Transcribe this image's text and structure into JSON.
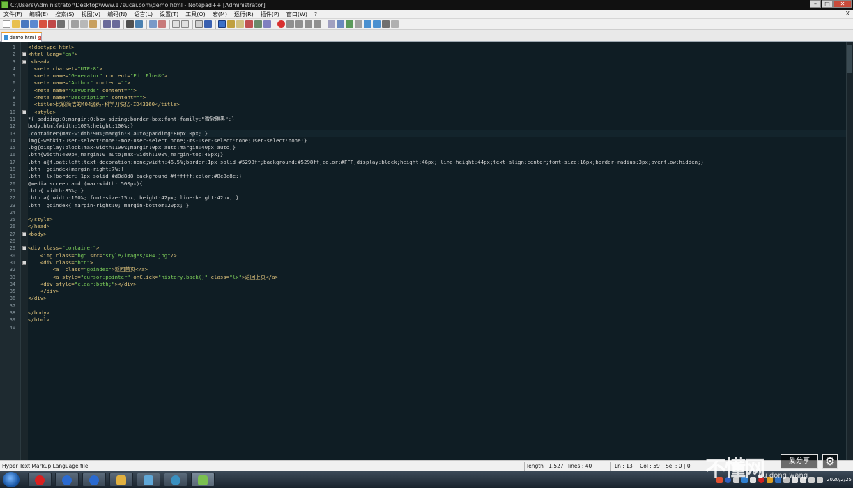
{
  "window": {
    "title": "C:\\Users\\Administrator\\Desktop\\www.17sucai.com\\demo.html - Notepad++ [Administrator]",
    "min": "–",
    "max": "□",
    "close": "✕"
  },
  "menu": [
    "文件(F)",
    "编辑(E)",
    "搜索(S)",
    "视图(V)",
    "编码(N)",
    "语言(L)",
    "设置(T)",
    "工具(O)",
    "宏(M)",
    "运行(R)",
    "插件(P)",
    "窗口(W)",
    "?"
  ],
  "menu_close": "X",
  "tab": {
    "label": "demo.html",
    "close": "x"
  },
  "code_lines": [
    {
      "n": "1",
      "text": "<!doctype html>",
      "fold": false
    },
    {
      "n": "2",
      "text": "<html lang=\"en\">",
      "fold": true
    },
    {
      "n": "3",
      "text": " <head>",
      "fold": true
    },
    {
      "n": "4",
      "text": "  <meta charset=\"UTF-8\">",
      "fold": false
    },
    {
      "n": "5",
      "text": "  <meta name=\"Generator\" content=\"EditPlus®\">",
      "fold": false
    },
    {
      "n": "6",
      "text": "  <meta name=\"Author\" content=\"\">",
      "fold": false
    },
    {
      "n": "7",
      "text": "  <meta name=\"Keywords\" content=\"\">",
      "fold": false
    },
    {
      "n": "8",
      "text": "  <meta name=\"Description\" content=\"\">",
      "fold": false
    },
    {
      "n": "9",
      "text": "  <title>比较简洁的404源码-科学刀佚亿-ID43160</title>",
      "fold": false
    },
    {
      "n": "10",
      "text": "  <style>",
      "fold": true
    },
    {
      "n": "11",
      "text": "*{ padding:0;margin:0;box-sizing:border-box;font-family:\"微软雅黑\";}",
      "fold": false
    },
    {
      "n": "12",
      "text": "body,html{width:100%;height:100%;}",
      "fold": false
    },
    {
      "n": "13",
      "text": ".container{max-width:90%;margin:0 auto;padding:80px 0px; }",
      "fold": false
    },
    {
      "n": "14",
      "text": "img{-webkit-user-select:none;-moz-user-select:none;-ms-user-select:none;user-select:none;}",
      "fold": false
    },
    {
      "n": "15",
      "text": ".bg{display:block;max-width:100%;margin:0px auto;margin:40px auto;}",
      "fold": false
    },
    {
      "n": "16",
      "text": ".btn{width:400px;margin:0 auto;max-width:100%;margin-top:40px;}",
      "fold": false
    },
    {
      "n": "17",
      "text": ".btn a{float:left;text-decoration:none;width:46.5%;border:1px solid #5298ff;background:#5298ff;color:#FFF;display:block;height:46px; line-height:44px;text-align:center;font-size:16px;border-radius:3px;overflow:hidden;}",
      "fold": false
    },
    {
      "n": "18",
      "text": ".btn .goindex{margin-right:7%;}",
      "fold": false
    },
    {
      "n": "19",
      "text": ".btn .lx{border: 1px solid #d8d8d8;background:#ffffff;color:#8c8c8c;}",
      "fold": false
    },
    {
      "n": "20",
      "text": "@media screen and (max-width: 500px){",
      "fold": false
    },
    {
      "n": "21",
      "text": ".btn{ width:85%; }",
      "fold": false
    },
    {
      "n": "22",
      "text": ".btn a{ width:100%; font-size:15px; height:42px; line-height:42px; }",
      "fold": false
    },
    {
      "n": "23",
      "text": ".btn .goindex{ margin-right:0; margin-bottom:20px; }",
      "fold": false
    },
    {
      "n": "24",
      "text": "",
      "fold": false
    },
    {
      "n": "25",
      "text": "</style>",
      "fold": false
    },
    {
      "n": "26",
      "text": "</head>",
      "fold": false
    },
    {
      "n": "27",
      "text": "<body>",
      "fold": true
    },
    {
      "n": "28",
      "text": "",
      "fold": false
    },
    {
      "n": "29",
      "text": "<div class=\"container\">",
      "fold": true
    },
    {
      "n": "30",
      "text": "    <img class=\"bg\" src=\"style/images/404.jpg\"/>",
      "fold": false
    },
    {
      "n": "31",
      "text": "    <div class=\"btn\">",
      "fold": true
    },
    {
      "n": "32",
      "text": "        <a  class=\"goindex\">返回首页</a>",
      "fold": false
    },
    {
      "n": "33",
      "text": "        <a style=\"cursor:pointer\" onClick=\"history.back()\" class=\"lx\">返回上页</a>",
      "fold": false
    },
    {
      "n": "34",
      "text": "    <div style=\"clear:both;\"></div>",
      "fold": false
    },
    {
      "n": "35",
      "text": "    </div>",
      "fold": false
    },
    {
      "n": "36",
      "text": "</div>",
      "fold": false
    },
    {
      "n": "37",
      "text": "",
      "fold": false
    },
    {
      "n": "38",
      "text": "</body>",
      "fold": false
    },
    {
      "n": "39",
      "text": "</html>",
      "fold": false
    },
    {
      "n": "40",
      "text": "",
      "fold": false
    }
  ],
  "current_line": "13",
  "status": {
    "filetype": "Hyper Text Markup Language file",
    "length": "length : 1,527",
    "lines": "lines : 40",
    "ln": "Ln : 13",
    "col": "Col : 59",
    "sel": "Sel : 0 | 0"
  },
  "clock": {
    "date": "2020/2/25"
  },
  "watermark": {
    "main": "不懂网",
    "sub": "bu dong wang",
    "badge": "爱分享"
  },
  "colors": {
    "editor_bg": "#0f1d24",
    "tag": "#e2c57c",
    "attr_value": "#7ecf5a",
    "tab_accent": "#f29c20"
  }
}
